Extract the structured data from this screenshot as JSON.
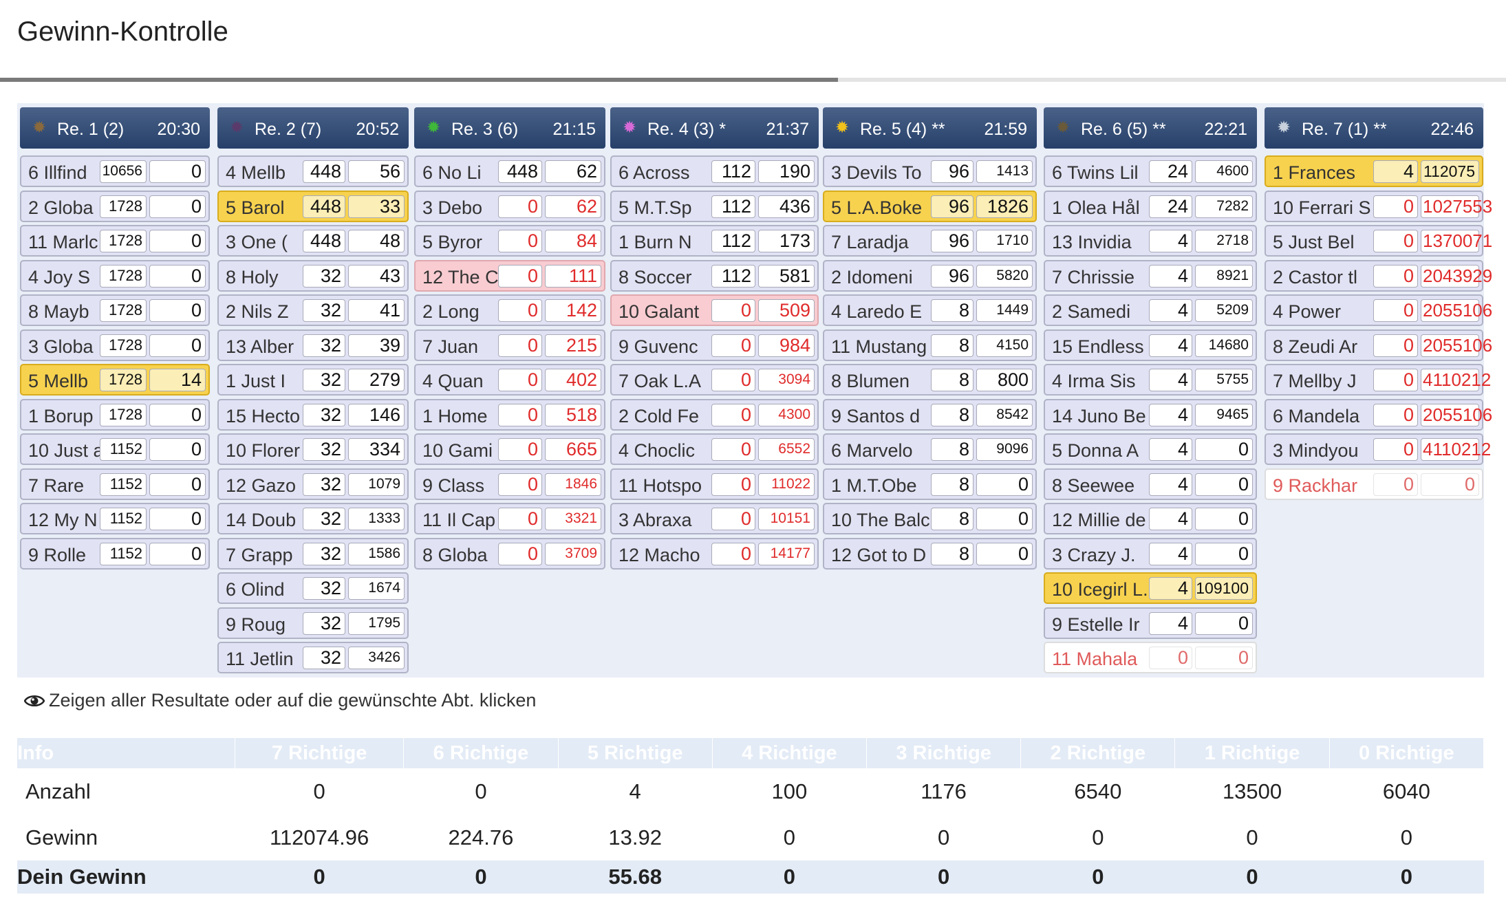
{
  "page": {
    "title": "Gewinn-Kontrolle"
  },
  "hint": {
    "text": "Zeigen aller Resultate oder auf die gewünschte Abt. klicken"
  },
  "races": [
    {
      "label": "Re. 1 (2)",
      "time": "20:30",
      "dot_color": "#8a6a3c",
      "rows": [
        {
          "name": "6 Illfind",
          "a": "10656",
          "b": "0",
          "state": "normal"
        },
        {
          "name": "2 Globa",
          "a": "1728",
          "b": "0",
          "state": "normal"
        },
        {
          "name": "11 Marlc",
          "a": "1728",
          "b": "0",
          "state": "normal"
        },
        {
          "name": "4 Joy S",
          "a": "1728",
          "b": "0",
          "state": "normal"
        },
        {
          "name": "8 Mayb",
          "a": "1728",
          "b": "0",
          "state": "normal"
        },
        {
          "name": "3 Globa",
          "a": "1728",
          "b": "0",
          "state": "normal"
        },
        {
          "name": "5 Mellb",
          "a": "1728",
          "b": "14",
          "state": "win"
        },
        {
          "name": "1 Borup",
          "a": "1728",
          "b": "0",
          "state": "normal"
        },
        {
          "name": "10 Just a",
          "a": "1152",
          "b": "0",
          "state": "normal"
        },
        {
          "name": "7 Rare",
          "a": "1152",
          "b": "0",
          "state": "normal"
        },
        {
          "name": "12 My N",
          "a": "1152",
          "b": "0",
          "state": "normal"
        },
        {
          "name": "9 Rolle",
          "a": "1152",
          "b": "0",
          "state": "normal"
        }
      ]
    },
    {
      "label": "Re. 2 (7)",
      "time": "20:52",
      "dot_color": "#5a3a6a",
      "rows": [
        {
          "name": "4 Mellb",
          "a": "448",
          "b": "56",
          "state": "normal"
        },
        {
          "name": "5 Barol",
          "a": "448",
          "b": "33",
          "state": "win"
        },
        {
          "name": "3 One (",
          "a": "448",
          "b": "48",
          "state": "normal"
        },
        {
          "name": "8 Holy",
          "a": "32",
          "b": "43",
          "state": "normal"
        },
        {
          "name": "2 Nils Z",
          "a": "32",
          "b": "41",
          "state": "normal"
        },
        {
          "name": "13 Alber",
          "a": "32",
          "b": "39",
          "state": "normal"
        },
        {
          "name": "1 Just I",
          "a": "32",
          "b": "279",
          "state": "normal"
        },
        {
          "name": "15 Hecto",
          "a": "32",
          "b": "146",
          "state": "normal"
        },
        {
          "name": "10 Florer",
          "a": "32",
          "b": "334",
          "state": "normal"
        },
        {
          "name": "12 Gazo",
          "a": "32",
          "b": "1079",
          "state": "normal"
        },
        {
          "name": "14 Doub",
          "a": "32",
          "b": "1333",
          "state": "normal"
        },
        {
          "name": "7 Grapp",
          "a": "32",
          "b": "1586",
          "state": "normal"
        },
        {
          "name": "6 Olind",
          "a": "32",
          "b": "1674",
          "state": "normal"
        },
        {
          "name": "9 Roug",
          "a": "32",
          "b": "1795",
          "state": "normal"
        },
        {
          "name": "11 Jetlin",
          "a": "32",
          "b": "3426",
          "state": "normal"
        }
      ]
    },
    {
      "label": "Re. 3 (6)",
      "time": "21:15",
      "dot_color": "#3fb83a",
      "rows": [
        {
          "name": "6 No Li",
          "a": "448",
          "b": "62",
          "state": "normal"
        },
        {
          "name": "3 Debo",
          "a": "0",
          "b": "62",
          "state": "normal"
        },
        {
          "name": "5 Byror",
          "a": "0",
          "b": "84",
          "state": "normal"
        },
        {
          "name": "12 The C",
          "a": "0",
          "b": "111",
          "state": "pink"
        },
        {
          "name": "2 Long",
          "a": "0",
          "b": "142",
          "state": "normal"
        },
        {
          "name": "7 Juan",
          "a": "0",
          "b": "215",
          "state": "normal"
        },
        {
          "name": "4 Quan",
          "a": "0",
          "b": "402",
          "state": "normal"
        },
        {
          "name": "1 Home",
          "a": "0",
          "b": "518",
          "state": "normal"
        },
        {
          "name": "10 Gami",
          "a": "0",
          "b": "665",
          "state": "normal"
        },
        {
          "name": "9 Class",
          "a": "0",
          "b": "1846",
          "state": "normal"
        },
        {
          "name": "11 Il Cap",
          "a": "0",
          "b": "3321",
          "state": "normal"
        },
        {
          "name": "8 Globa",
          "a": "0",
          "b": "3709",
          "state": "normal"
        }
      ]
    },
    {
      "label": "Re. 4 (3) *",
      "time": "21:37",
      "dot_color": "#d86ad8",
      "rows": [
        {
          "name": "6 Across",
          "a": "112",
          "b": "190",
          "state": "normal"
        },
        {
          "name": "5 M.T.Sp",
          "a": "112",
          "b": "436",
          "state": "normal"
        },
        {
          "name": "1 Burn N",
          "a": "112",
          "b": "173",
          "state": "normal"
        },
        {
          "name": "8 Soccer",
          "a": "112",
          "b": "581",
          "state": "normal"
        },
        {
          "name": "10 Galant",
          "a": "0",
          "b": "509",
          "state": "pink"
        },
        {
          "name": "9 Guvenc",
          "a": "0",
          "b": "984",
          "state": "normal"
        },
        {
          "name": "7 Oak L.A",
          "a": "0",
          "b": "3094",
          "state": "normal"
        },
        {
          "name": "2 Cold Fe",
          "a": "0",
          "b": "4300",
          "state": "normal"
        },
        {
          "name": "4 Choclic",
          "a": "0",
          "b": "6552",
          "state": "normal"
        },
        {
          "name": "11 Hotspo",
          "a": "0",
          "b": "11022",
          "state": "normal"
        },
        {
          "name": "3 Abraxa",
          "a": "0",
          "b": "10151",
          "state": "normal"
        },
        {
          "name": "12 Macho",
          "a": "0",
          "b": "14177",
          "state": "normal"
        }
      ]
    },
    {
      "label": "Re. 5 (4) **",
      "time": "21:59",
      "dot_color": "#f2c21c",
      "rows": [
        {
          "name": "3 Devils To",
          "a": "96",
          "b": "1413",
          "state": "normal"
        },
        {
          "name": "5 L.A.Boke",
          "a": "96",
          "b": "1826",
          "state": "win"
        },
        {
          "name": "7 Laradja",
          "a": "96",
          "b": "1710",
          "state": "normal"
        },
        {
          "name": "2 Idomeni",
          "a": "96",
          "b": "5820",
          "state": "normal"
        },
        {
          "name": "4 Laredo E",
          "a": "8",
          "b": "1449",
          "state": "normal"
        },
        {
          "name": "11 Mustang",
          "a": "8",
          "b": "4150",
          "state": "normal"
        },
        {
          "name": "8 Blumen",
          "a": "8",
          "b": "800",
          "state": "normal"
        },
        {
          "name": "9 Santos d",
          "a": "8",
          "b": "8542",
          "state": "normal"
        },
        {
          "name": "6 Marvelo",
          "a": "8",
          "b": "9096",
          "state": "normal"
        },
        {
          "name": "1 M.T.Obe",
          "a": "8",
          "b": "0",
          "state": "normal"
        },
        {
          "name": "10 The Balc",
          "a": "8",
          "b": "0",
          "state": "normal"
        },
        {
          "name": "12 Got to D",
          "a": "8",
          "b": "0",
          "state": "normal"
        }
      ]
    },
    {
      "label": "Re. 6 (5) **",
      "time": "22:21",
      "dot_color": "#6a5a3a",
      "rows": [
        {
          "name": "6 Twins Lil",
          "a": "24",
          "b": "4600",
          "state": "normal"
        },
        {
          "name": "1 Olea Hål",
          "a": "24",
          "b": "7282",
          "state": "normal"
        },
        {
          "name": "13 Invidia",
          "a": "4",
          "b": "2718",
          "state": "normal"
        },
        {
          "name": "7 Chrissie",
          "a": "4",
          "b": "8921",
          "state": "normal"
        },
        {
          "name": "2 Samedi",
          "a": "4",
          "b": "5209",
          "state": "normal"
        },
        {
          "name": "15 Endless",
          "a": "4",
          "b": "14680",
          "state": "normal"
        },
        {
          "name": "4 Irma Sis",
          "a": "4",
          "b": "5755",
          "state": "normal"
        },
        {
          "name": "14 Juno Be",
          "a": "4",
          "b": "9465",
          "state": "normal"
        },
        {
          "name": "5 Donna A",
          "a": "4",
          "b": "0",
          "state": "normal"
        },
        {
          "name": "8 Seewee",
          "a": "4",
          "b": "0",
          "state": "normal"
        },
        {
          "name": "12 Millie de",
          "a": "4",
          "b": "0",
          "state": "normal"
        },
        {
          "name": "3 Crazy J.",
          "a": "4",
          "b": "0",
          "state": "normal"
        },
        {
          "name": "10 Icegirl L.",
          "a": "4",
          "b": "109100",
          "state": "win"
        },
        {
          "name": "9 Estelle Ir",
          "a": "4",
          "b": "0",
          "state": "normal"
        },
        {
          "name": "11 Mahala",
          "a": "0",
          "b": "0",
          "state": "out"
        }
      ]
    },
    {
      "label": "Re. 7 (1) **",
      "time": "22:46",
      "dot_color": "#c8d0dc",
      "rows": [
        {
          "name": "1 Frances",
          "a": "4",
          "b": "112075",
          "state": "win"
        },
        {
          "name": "10 Ferrari S",
          "a": "0",
          "b": "1027553",
          "state": "normal"
        },
        {
          "name": "5 Just Bel",
          "a": "0",
          "b": "1370071",
          "state": "normal"
        },
        {
          "name": "2 Castor tl",
          "a": "0",
          "b": "2043929",
          "state": "normal"
        },
        {
          "name": "4 Power",
          "a": "0",
          "b": "2055106",
          "state": "normal"
        },
        {
          "name": "8 Zeudi Ar",
          "a": "0",
          "b": "2055106",
          "state": "normal"
        },
        {
          "name": "7 Mellby J",
          "a": "0",
          "b": "4110212",
          "state": "normal"
        },
        {
          "name": "6 Mandela",
          "a": "0",
          "b": "2055106",
          "state": "normal"
        },
        {
          "name": "3 Mindyou",
          "a": "0",
          "b": "4110212",
          "state": "normal"
        },
        {
          "name": "9 Rackhar",
          "a": "0",
          "b": "0",
          "state": "out"
        }
      ]
    }
  ],
  "summary": {
    "headers": [
      "Info",
      "7 Richtige",
      "6 Richtige",
      "5 Richtige",
      "4 Richtige",
      "3 Richtige",
      "2 Richtige",
      "1 Richtige",
      "0 Richtige"
    ],
    "rows": [
      {
        "label": "Anzahl",
        "values": [
          "0",
          "0",
          "4",
          "100",
          "1176",
          "6540",
          "13500",
          "6040"
        ]
      },
      {
        "label": "Gewinn",
        "values": [
          "112074.96",
          "224.76",
          "13.92",
          "0",
          "0",
          "0",
          "0",
          "0"
        ]
      }
    ],
    "total": {
      "label": "Dein Gewinn",
      "values": [
        "0",
        "0",
        "55.68",
        "0",
        "0",
        "0",
        "0",
        "0"
      ]
    }
  }
}
